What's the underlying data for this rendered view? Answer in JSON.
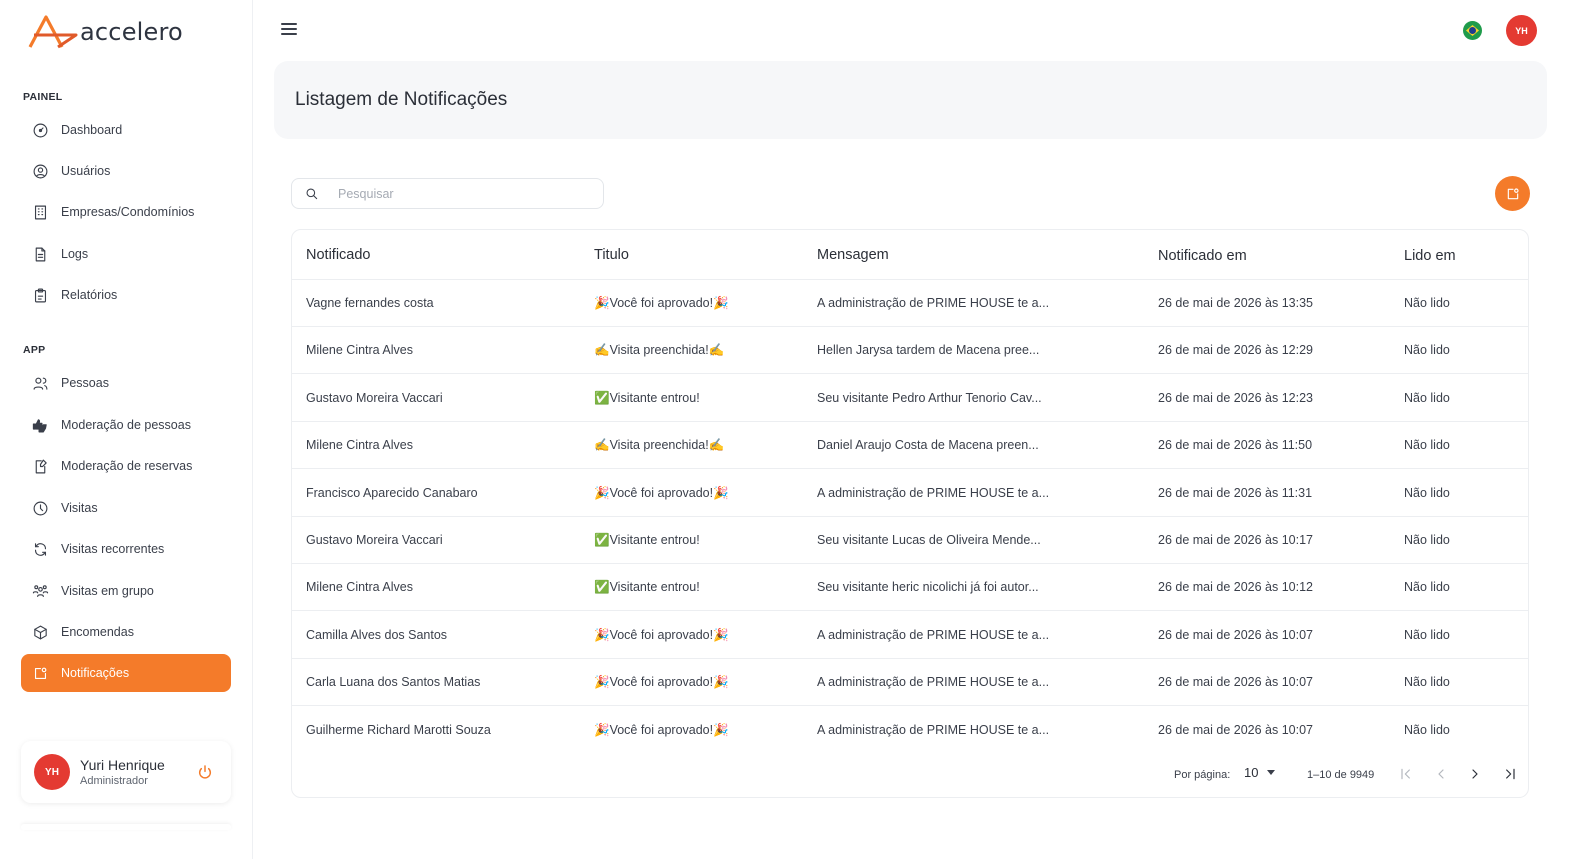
{
  "brand": {
    "name": "accelero",
    "accent": "#f47b2a",
    "avatar_color": "#e43a32"
  },
  "sidebar": {
    "section_painel": "PAINEL",
    "section_app": "APP",
    "painel_items": [
      {
        "label": "Dashboard",
        "icon": "dashboard-icon"
      },
      {
        "label": "Usuários",
        "icon": "user-circle-icon"
      },
      {
        "label": "Empresas/Condomínios",
        "icon": "building-icon"
      },
      {
        "label": "Logs",
        "icon": "file-icon"
      },
      {
        "label": "Relatórios",
        "icon": "clipboard-icon"
      }
    ],
    "app_items": [
      {
        "label": "Pessoas",
        "icon": "people-icon"
      },
      {
        "label": "Moderação de pessoas",
        "icon": "thumbs-icon"
      },
      {
        "label": "Moderação de reservas",
        "icon": "reservation-icon"
      },
      {
        "label": "Visitas",
        "icon": "clock-icon"
      },
      {
        "label": "Visitas recorrentes",
        "icon": "refresh-icon"
      },
      {
        "label": "Visitas em grupo",
        "icon": "group-icon"
      },
      {
        "label": "Encomendas",
        "icon": "package-icon"
      },
      {
        "label": "Notificações",
        "icon": "notification-icon",
        "active": true
      }
    ],
    "user": {
      "initials": "YH",
      "name": "Yuri Henrique",
      "role": "Administrador"
    }
  },
  "topbar": {
    "avatar_initials": "YH",
    "language_flag": "brazil-flag-icon"
  },
  "page": {
    "title": "Listagem de Notificações"
  },
  "search": {
    "placeholder": "Pesquisar",
    "value": ""
  },
  "table": {
    "columns": [
      "Notificado",
      "Titulo",
      "Mensagem",
      "Notificado em",
      "Lido em"
    ],
    "rows": [
      [
        "Vagne fernandes costa",
        "🎉Você foi aprovado!🎉",
        "A administração de PRIME HOUSE te a...",
        "26 de mai de 2026 às 13:35",
        "Não lido"
      ],
      [
        "Milene Cintra Alves",
        "✍️Visita preenchida!✍️",
        "Hellen Jarysa tardem de Macena pree...",
        "26 de mai de 2026 às 12:29",
        "Não lido"
      ],
      [
        "Gustavo Moreira Vaccari",
        "✅Visitante entrou!",
        "Seu visitante Pedro Arthur Tenorio Cav...",
        "26 de mai de 2026 às 12:23",
        "Não lido"
      ],
      [
        "Milene Cintra Alves",
        "✍️Visita preenchida!✍️",
        "Daniel Araujo Costa de Macena preen...",
        "26 de mai de 2026 às 11:50",
        "Não lido"
      ],
      [
        "Francisco Aparecido Canabaro",
        "🎉Você foi aprovado!🎉",
        "A administração de PRIME HOUSE te a...",
        "26 de mai de 2026 às 11:31",
        "Não lido"
      ],
      [
        "Gustavo Moreira Vaccari",
        "✅Visitante entrou!",
        "Seu visitante Lucas de Oliveira Mende...",
        "26 de mai de 2026 às 10:17",
        "Não lido"
      ],
      [
        "Milene Cintra Alves",
        "✅Visitante entrou!",
        "Seu visitante heric nicolichi já foi autor...",
        "26 de mai de 2026 às 10:12",
        "Não lido"
      ],
      [
        "Camilla Alves dos Santos",
        "🎉Você foi aprovado!🎉",
        "A administração de PRIME HOUSE te a...",
        "26 de mai de 2026 às 10:07",
        "Não lido"
      ],
      [
        "Carla Luana dos Santos Matias",
        "🎉Você foi aprovado!🎉",
        "A administração de PRIME HOUSE te a...",
        "26 de mai de 2026 às 10:07",
        "Não lido"
      ],
      [
        "Guilherme Richard Marotti Souza",
        "🎉Você foi aprovado!🎉",
        "A administração de PRIME HOUSE te a...",
        "26 de mai de 2026 às 10:07",
        "Não lido"
      ]
    ]
  },
  "pagination": {
    "per_page_label": "Por página:",
    "per_page_value": "10",
    "range": "1–10 de 9949"
  }
}
